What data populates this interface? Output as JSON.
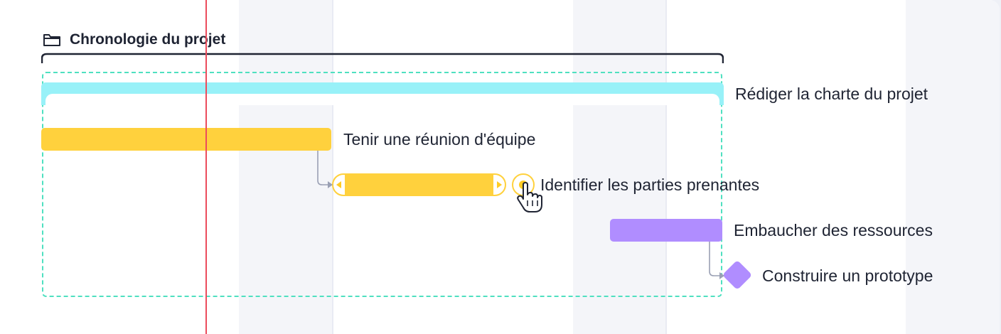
{
  "group": {
    "title": "Chronologie du projet",
    "icon": "folder-icon"
  },
  "tasks": [
    {
      "id": "t1",
      "label": "Rédiger la charte du projet",
      "color": "#98f1f8",
      "kind": "summary"
    },
    {
      "id": "t2",
      "label": "Tenir une réunion d'équipe",
      "color": "#ffd13d",
      "kind": "task"
    },
    {
      "id": "t3",
      "label": "Identifier les parties prenantes",
      "color": "#ffd13d",
      "kind": "task",
      "selected": true
    },
    {
      "id": "t4",
      "label": "Embaucher des ressources",
      "color": "#b08dff",
      "kind": "task"
    },
    {
      "id": "t5",
      "label": "Construire un prototype",
      "color": "#b08dff",
      "kind": "milestone"
    }
  ],
  "colors": {
    "today_line": "#ec4c5c",
    "group_outline": "#4fe0c0",
    "dependency_arrow": "#9aa0b4"
  },
  "cursor": "hand-pointer-icon"
}
